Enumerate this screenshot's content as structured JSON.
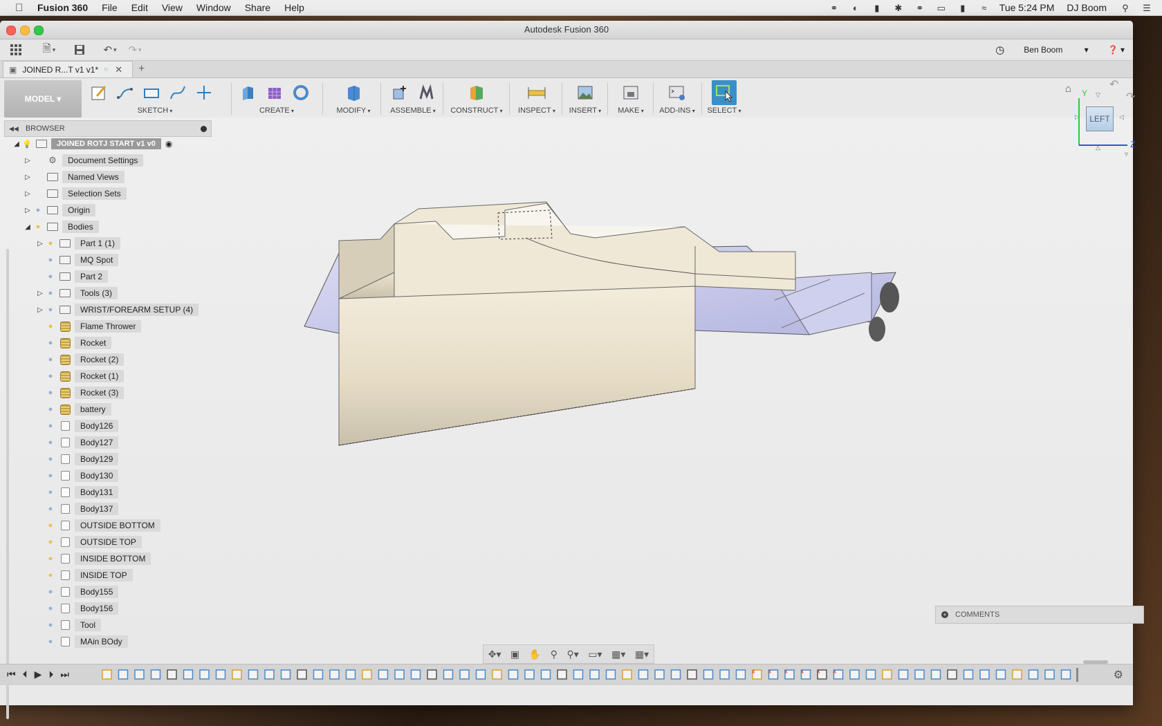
{
  "menubar": {
    "app_name": "Fusion 360",
    "items": [
      "File",
      "Edit",
      "View",
      "Window",
      "Share",
      "Help"
    ],
    "clock": "Tue 5:24 PM",
    "user": "DJ Boom"
  },
  "window": {
    "title": "Autodesk Fusion 360",
    "account": "Ben Boom",
    "doc_tab": "JOINED R...T v1 v1*"
  },
  "toolbar": {
    "workspace": "MODEL ▾",
    "groups": [
      "SKETCH",
      "CREATE",
      "MODIFY",
      "ASSEMBLE",
      "CONSTRUCT",
      "INSPECT",
      "INSERT",
      "MAKE",
      "ADD-INS",
      "SELECT"
    ]
  },
  "browser": {
    "title": "BROWSER",
    "root": "JOINED ROTJ START v1 v0",
    "items": [
      {
        "label": "Document Settings",
        "level": 0,
        "icon": "gear",
        "bulb": "none",
        "arrow": "right"
      },
      {
        "label": "Named Views",
        "level": 0,
        "icon": "folder",
        "bulb": "none",
        "arrow": "right"
      },
      {
        "label": "Selection Sets",
        "level": 0,
        "icon": "folder",
        "bulb": "none",
        "arrow": "right"
      },
      {
        "label": "Origin",
        "level": 0,
        "icon": "folder",
        "bulb": "off",
        "arrow": "right"
      },
      {
        "label": "Bodies",
        "level": 0,
        "icon": "folder",
        "bulb": "on",
        "arrow": "down"
      },
      {
        "label": "Part 1 (1)",
        "level": 1,
        "icon": "folder",
        "bulb": "on",
        "arrow": "right"
      },
      {
        "label": "MQ Spot",
        "level": 1,
        "icon": "folder",
        "bulb": "off",
        "arrow": "none"
      },
      {
        "label": "Part 2",
        "level": 1,
        "icon": "folder",
        "bulb": "off",
        "arrow": "none"
      },
      {
        "label": "Tools (3)",
        "level": 1,
        "icon": "folder",
        "bulb": "off",
        "arrow": "right"
      },
      {
        "label": "WRIST/FOREARM SETUP (4)",
        "level": 1,
        "icon": "folder",
        "bulb": "off",
        "arrow": "right"
      },
      {
        "label": "Flame Thrower",
        "level": 1,
        "icon": "comp",
        "bulb": "on",
        "arrow": "none"
      },
      {
        "label": "Rocket",
        "level": 1,
        "icon": "comp",
        "bulb": "off",
        "arrow": "none"
      },
      {
        "label": "Rocket (2)",
        "level": 1,
        "icon": "comp",
        "bulb": "off",
        "arrow": "none"
      },
      {
        "label": "Rocket (1)",
        "level": 1,
        "icon": "comp",
        "bulb": "off",
        "arrow": "none"
      },
      {
        "label": "Rocket (3)",
        "level": 1,
        "icon": "comp",
        "bulb": "off",
        "arrow": "none"
      },
      {
        "label": "battery",
        "level": 1,
        "icon": "comp",
        "bulb": "off",
        "arrow": "none"
      },
      {
        "label": "Body126",
        "level": 1,
        "icon": "body",
        "bulb": "off",
        "arrow": "none"
      },
      {
        "label": "Body127",
        "level": 1,
        "icon": "body",
        "bulb": "off",
        "arrow": "none"
      },
      {
        "label": "Body129",
        "level": 1,
        "icon": "body",
        "bulb": "off",
        "arrow": "none"
      },
      {
        "label": "Body130",
        "level": 1,
        "icon": "body",
        "bulb": "off",
        "arrow": "none"
      },
      {
        "label": "Body131",
        "level": 1,
        "icon": "body",
        "bulb": "off",
        "arrow": "none"
      },
      {
        "label": "Body137",
        "level": 1,
        "icon": "body",
        "bulb": "off",
        "arrow": "none"
      },
      {
        "label": "OUTSIDE BOTTOM",
        "level": 1,
        "icon": "body",
        "bulb": "on",
        "arrow": "none"
      },
      {
        "label": "OUTSIDE TOP",
        "level": 1,
        "icon": "body",
        "bulb": "on",
        "arrow": "none"
      },
      {
        "label": "INSIDE BOTTOM",
        "level": 1,
        "icon": "body",
        "bulb": "on",
        "arrow": "none"
      },
      {
        "label": "INSIDE TOP",
        "level": 1,
        "icon": "body",
        "bulb": "on",
        "arrow": "none"
      },
      {
        "label": "Body155",
        "level": 1,
        "icon": "body",
        "bulb": "off",
        "arrow": "none"
      },
      {
        "label": "Body156",
        "level": 1,
        "icon": "body",
        "bulb": "off",
        "arrow": "none"
      },
      {
        "label": "Tool",
        "level": 1,
        "icon": "body",
        "bulb": "off",
        "arrow": "none"
      },
      {
        "label": "MAin BOdy",
        "level": 1,
        "icon": "body",
        "bulb": "off",
        "arrow": "none"
      }
    ]
  },
  "viewcube": {
    "face": "LEFT",
    "axis_y": "Y",
    "axis_z": "Z"
  },
  "comments": {
    "label": "COMMENTS"
  },
  "colors": {
    "accent": "#3a8fc7",
    "bulb_on": "#e8c24a",
    "bulb_off": "#9aaed0",
    "model_beige": "#efe7d6",
    "model_blue": "#c9cae8"
  }
}
